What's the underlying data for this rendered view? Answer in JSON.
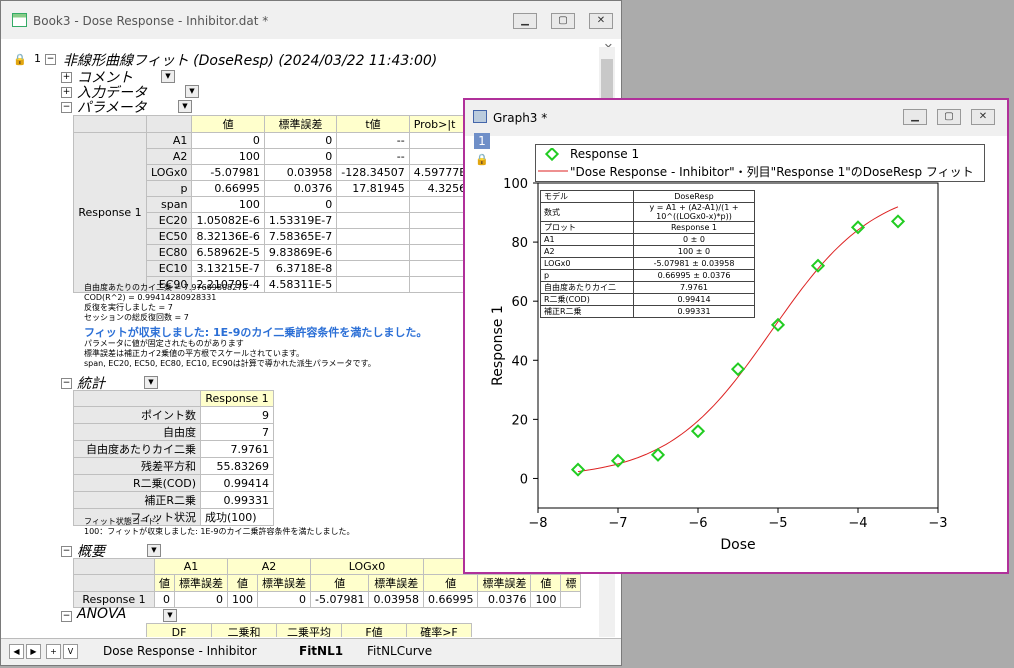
{
  "workbook": {
    "title": "Book3 - Dose Response - Inhibitor.dat *",
    "row_number": "1",
    "header": "非線形曲線フィット (DoseResp) (2024/03/22 11:43:00)",
    "sections": {
      "comment": "コメント",
      "input": "入力データ",
      "params": "パラメータ",
      "stats": "統計",
      "summary": "概要",
      "anova": "ANOVA"
    },
    "params_table": {
      "headers": [
        "値",
        "標準誤差",
        "t値",
        "Prob>|t"
      ],
      "group": "Response 1",
      "rows": [
        [
          "A1",
          "0",
          "0",
          "--",
          ""
        ],
        [
          "A2",
          "100",
          "0",
          "--",
          ""
        ],
        [
          "LOGx0",
          "-5.07981",
          "0.03958",
          "-128.34507",
          "4.59777E"
        ],
        [
          "p",
          "0.66995",
          "0.0376",
          "17.81945",
          "4.3256"
        ],
        [
          "span",
          "100",
          "0",
          "",
          ""
        ],
        [
          "EC20",
          "1.05082E-6",
          "1.53319E-7",
          "",
          ""
        ],
        [
          "EC50",
          "8.32136E-6",
          "7.58365E-7",
          "",
          ""
        ],
        [
          "EC80",
          "6.58962E-5",
          "9.83869E-6",
          "",
          ""
        ],
        [
          "EC10",
          "3.13215E-7",
          "6.3718E-8",
          "",
          ""
        ],
        [
          "EC90",
          "2.21079E-4",
          "4.58311E-5",
          "",
          ""
        ]
      ]
    },
    "notes1": [
      "自由度あたりのカイ二乗 = 7.97609808279",
      "COD(R^2) = 0.99414280928331",
      "反復を実行しました = 7",
      "セッションの総反復回数 = 7"
    ],
    "converged": "フィットが収束しました: 1E-9のカイ二乗許容条件を満たしました。",
    "notes2": [
      "パラメータに値が固定されたものがあります",
      "標準誤差は補正カイ2乗値の平方根でスケールされています。",
      "span, EC20, EC50, EC80, EC10, EC90は計算で導かれた派生パラメータです。"
    ],
    "stats_table": {
      "col": "Response 1",
      "rows": [
        [
          "ポイント数",
          "9"
        ],
        [
          "自由度",
          "7"
        ],
        [
          "自由度あたりカイ二乗",
          "7.9761"
        ],
        [
          "残差平方和",
          "55.83269"
        ],
        [
          "R二乗(COD)",
          "0.99414"
        ],
        [
          "補正R二乗",
          "0.99331"
        ],
        [
          "フィット状況",
          "成功(100)"
        ]
      ]
    },
    "fit_notes": [
      "フィット状態コード：",
      "100：フィットが収束しました: 1E-9のカイ二乗許容条件を満たしました。"
    ],
    "summary_table": {
      "groups": [
        "A1",
        "A2",
        "LOGx0"
      ],
      "sub": [
        "値",
        "標準誤差",
        "値",
        "標準誤差",
        "値",
        "標準誤差",
        "値",
        "標準誤差",
        "値",
        "標"
      ],
      "row": [
        "Response 1",
        "0",
        "0",
        "100",
        "0",
        "-5.07981",
        "0.03958",
        "0.66995",
        "0.0376",
        "100",
        ""
      ]
    },
    "anova_headers": [
      "DF",
      "二乗和",
      "二乗平均",
      "F値",
      "確率>F"
    ],
    "tabs": [
      "Dose Response - Inhibitor",
      "FitNL1",
      "FitNLCurve"
    ],
    "tab_nav": [
      "◀",
      "▶",
      "+",
      "V"
    ]
  },
  "graph": {
    "title": "Graph3 *",
    "layer": "1",
    "legend": [
      "Response 1",
      "\"Dose Response - Inhibitor\"・列目\"Response 1\"のDoseResp フィット"
    ],
    "colors": {
      "points": "#22cc22",
      "fit": "#dd2222",
      "frame": "#b0309a"
    },
    "info_table": [
      [
        "モデル",
        "DoseResp"
      ],
      [
        "数式",
        "y = A1 + (A2-A1)/(1 + 10^((LOGx0-x)*p))"
      ],
      [
        "プロット",
        "Response 1"
      ],
      [
        "A1",
        "0 ± 0"
      ],
      [
        "A2",
        "100 ± 0"
      ],
      [
        "LOGx0",
        "-5.07981 ± 0.03958"
      ],
      [
        "p",
        "0.66995 ± 0.0376"
      ],
      [
        "自由度あたりカイ二",
        "7.9761"
      ],
      [
        "R二乗(COD)",
        "0.99414"
      ],
      [
        "補正R二乗",
        "0.99331"
      ]
    ]
  },
  "chart_data": {
    "type": "scatter",
    "xlabel": "Dose",
    "ylabel": "Response 1",
    "xlim": [
      -8,
      -3
    ],
    "ylim": [
      -10,
      100
    ],
    "xticks": [
      -8,
      -7,
      -6,
      -5,
      -4,
      -3
    ],
    "yticks": [
      0,
      20,
      40,
      60,
      80,
      100
    ],
    "series": [
      {
        "name": "Response 1",
        "x": [
          -7.5,
          -7,
          -6.5,
          -6,
          -5.5,
          -5,
          -4.5,
          -4,
          -3.5
        ],
        "y": [
          3,
          6,
          8,
          16,
          37,
          52,
          72,
          85,
          87
        ]
      }
    ],
    "fit": {
      "A1": 0,
      "A2": 100,
      "LOGx0": -5.07981,
      "p": 0.66995,
      "x_range": [
        -7.5,
        -3.5
      ]
    }
  }
}
